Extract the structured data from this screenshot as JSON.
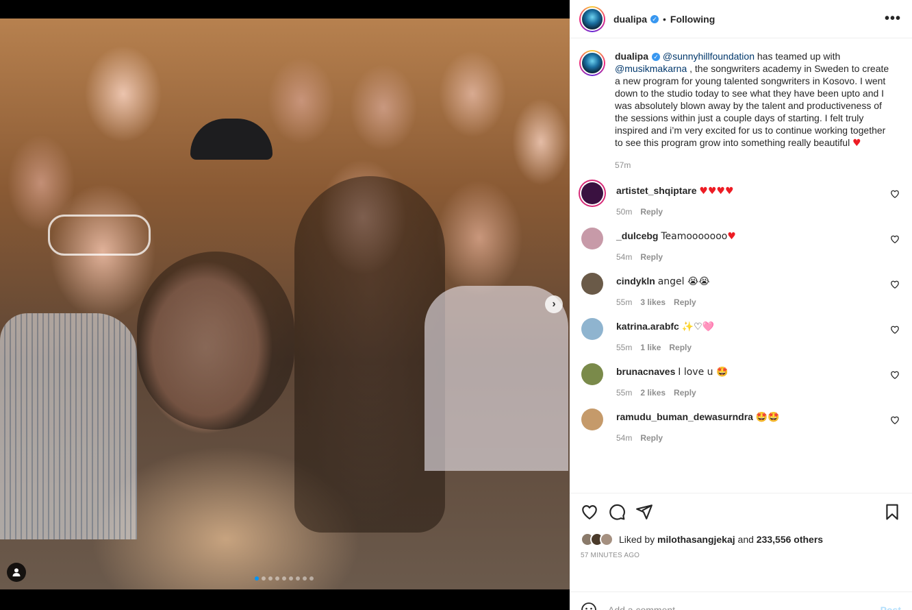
{
  "post": {
    "author": "dualipa",
    "follow_status": "Following",
    "separator": "•",
    "more_label": "•••",
    "verified_mark": "✓",
    "caption": {
      "mention1": "@sunnyhillfoundation",
      "text1": " has teamed up with ",
      "mention2": "@musikmakarna",
      "text2": " , the songwriters academy in Sweden to create a new program for young talented songwriters in Kosovo. I went down to the studio today to see what they have been upto and I was absolutely blown away by the talent and productiveness of the sessions within just a couple days of starting. I felt truly inspired and i’m very excited for us to continue working together to see this program grow into something really beautiful ",
      "emoji": "♥"
    },
    "caption_time": "57m"
  },
  "media": {
    "next_label": "›",
    "carousel_count": 9,
    "active_index": 0
  },
  "comments": [
    {
      "user": "artistet_shqiptare",
      "text": "♥♥♥♥",
      "time": "50m",
      "likes": "",
      "reply": "Reply",
      "avatar_color": "#3a1140"
    },
    {
      "user": "_dulcebg",
      "text": "Teamooooooo♥",
      "time": "54m",
      "likes": "",
      "reply": "Reply",
      "avatar_color": "#c79aa8"
    },
    {
      "user": "cindykln",
      "text": "angel 😭😭",
      "time": "55m",
      "likes": "3 likes",
      "reply": "Reply",
      "avatar_color": "#6a5a48"
    },
    {
      "user": "katrina.arabfc",
      "text": "✨♡🩷",
      "time": "55m",
      "likes": "1 like",
      "reply": "Reply",
      "avatar_color": "#8fb4cf"
    },
    {
      "user": "brunacnaves",
      "text": "I love u 🤩",
      "time": "55m",
      "likes": "2 likes",
      "reply": "Reply",
      "avatar_color": "#7a8a4a"
    },
    {
      "user": "ramudu_buman_dewasurndra",
      "text": "🤩🤩",
      "time": "54m",
      "likes": "",
      "reply": "Reply",
      "avatar_color": "#c59a6a"
    }
  ],
  "likes": {
    "prefix": "Liked by ",
    "user": "milothasangjekaj",
    "middle": " and ",
    "others": "233,556 others"
  },
  "post_time": "57 MINUTES AGO",
  "comment_box": {
    "placeholder": "Add a comment…",
    "post_label": "Post"
  }
}
